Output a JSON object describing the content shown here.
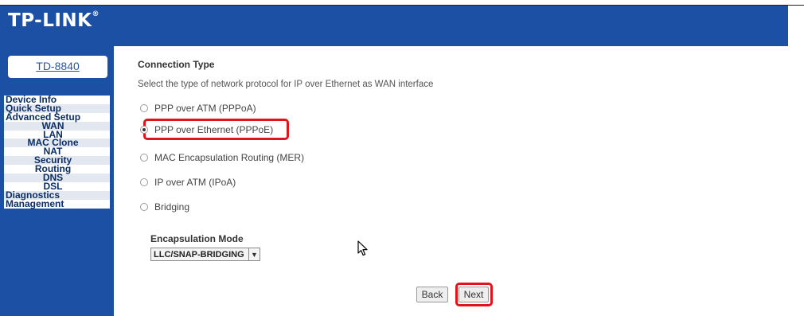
{
  "header": {
    "logo": "TP-LINK",
    "logo_mark": "®"
  },
  "sidebar": {
    "model": "TD-8840",
    "nav": [
      {
        "label": "Device Info",
        "type": "main"
      },
      {
        "label": "Quick Setup",
        "type": "main"
      },
      {
        "label": "Advanced Setup",
        "type": "main"
      },
      {
        "label": "WAN",
        "type": "sub"
      },
      {
        "label": "LAN",
        "type": "sub"
      },
      {
        "label": "MAC Clone",
        "type": "sub"
      },
      {
        "label": "NAT",
        "type": "sub"
      },
      {
        "label": "Security",
        "type": "sub"
      },
      {
        "label": "Routing",
        "type": "sub"
      },
      {
        "label": "DNS",
        "type": "sub"
      },
      {
        "label": "DSL",
        "type": "sub"
      },
      {
        "label": "Diagnostics",
        "type": "main"
      },
      {
        "label": "Management",
        "type": "main"
      }
    ]
  },
  "main": {
    "title": "Connection Type",
    "description": "Select the type of network protocol for IP over Ethernet as WAN interface",
    "options": [
      {
        "label": "PPP over ATM (PPPoA)",
        "checked": false
      },
      {
        "label": "PPP over Ethernet (PPPoE)",
        "checked": true
      },
      {
        "label": "MAC Encapsulation Routing (MER)",
        "checked": false
      },
      {
        "label": "IP over ATM (IPoA)",
        "checked": false
      },
      {
        "label": "Bridging",
        "checked": false
      }
    ],
    "encapsulation_label": "Encapsulation Mode",
    "encapsulation_value": "LLC/SNAP-BRIDGING",
    "back_label": "Back",
    "next_label": "Next"
  },
  "colors": {
    "brand_blue": "#1b50a5",
    "highlight_red": "#e0141b"
  }
}
